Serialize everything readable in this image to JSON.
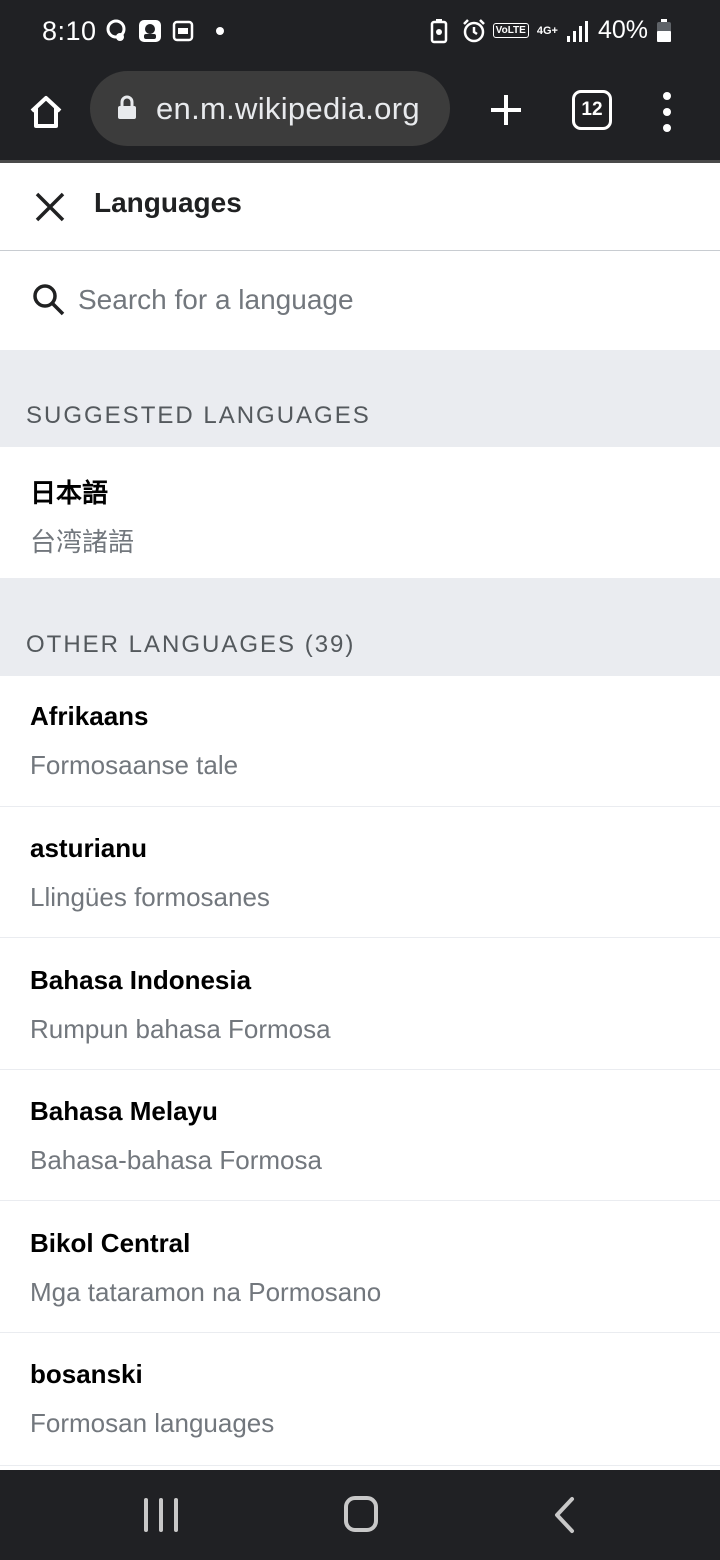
{
  "status_bar": {
    "time": "8:10",
    "battery": "40%",
    "volte": "VoLTE",
    "network": "4G+",
    "left_icons": [
      "network-activity-icon",
      "chat-app-icon",
      "app-notification-icon"
    ],
    "right_icons": [
      "battery-saver-icon",
      "alarm-icon",
      "volte-icon",
      "network-4g-icon",
      "signal-icon",
      "battery-icon"
    ]
  },
  "browser": {
    "url": "en.m.wikipedia.org",
    "tab_count": "12"
  },
  "panel": {
    "title": "Languages",
    "search_placeholder": "Search for a language"
  },
  "suggested": {
    "header": "SUGGESTED LANGUAGES",
    "items": [
      {
        "language": "日本語",
        "article": "台湾諸語"
      }
    ]
  },
  "other": {
    "header": "OTHER LANGUAGES (39)",
    "items": [
      {
        "language": "Afrikaans",
        "article": "Formosaanse tale"
      },
      {
        "language": "asturianu",
        "article": "Llingües formosanes"
      },
      {
        "language": "Bahasa Indonesia",
        "article": "Rumpun bahasa Formosa"
      },
      {
        "language": "Bahasa Melayu",
        "article": "Bahasa-bahasa Formosa"
      },
      {
        "language": "Bikol Central",
        "article": "Mga tataramon na Pormosano"
      },
      {
        "language": "bosanski",
        "article": "Formosan languages"
      }
    ]
  },
  "colors": {
    "chrome_dark": "#202124",
    "section_bg": "#eaecf0",
    "muted_text": "#72777d"
  }
}
